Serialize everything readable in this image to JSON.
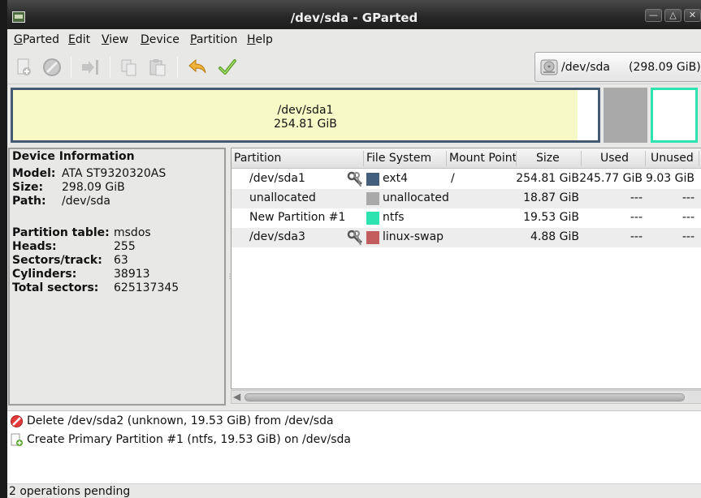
{
  "window": {
    "title": "/dev/sda - GParted"
  },
  "menubar": {
    "items": [
      {
        "mnemonic": "G",
        "rest": "Parted"
      },
      {
        "mnemonic": "E",
        "rest": "dit"
      },
      {
        "mnemonic": "V",
        "rest": "iew"
      },
      {
        "mnemonic": "D",
        "rest": "evice"
      },
      {
        "mnemonic": "P",
        "rest": "artition"
      },
      {
        "mnemonic": "H",
        "rest": "elp"
      }
    ]
  },
  "toolbar": {
    "icons": [
      "new-partition-icon",
      "delete-icon",
      "resize-move-icon",
      "copy-icon",
      "paste-icon",
      "undo-icon",
      "apply-icon"
    ],
    "device_selector": {
      "device": "/dev/sda",
      "size": "(298.09 GiB)",
      "icon": "hard-disk-icon"
    }
  },
  "disk_graphic": {
    "sda1": {
      "name": "/dev/sda1",
      "size": "254.81 GiB",
      "used_fraction": 0.965,
      "border_color": "#445a74",
      "fill_color": "#f7fac6"
    },
    "unallocated": {
      "color": "#a9a9a9"
    },
    "new_partition": {
      "border_color": "#2de3b0"
    }
  },
  "device_info": {
    "heading": "Device Information",
    "model_key": "Model:",
    "model": "ATA ST9320320AS",
    "size_key": "Size:",
    "size": "298.09 GiB",
    "path_key": "Path:",
    "path": "/dev/sda",
    "ptable_key": "Partition table:",
    "ptable": "msdos",
    "heads_key": "Heads:",
    "heads": "255",
    "sectors_key": "Sectors/track:",
    "sectors": "63",
    "cylinders_key": "Cylinders:",
    "cylinders": "38913",
    "total_key": "Total sectors:",
    "total": "625137345"
  },
  "partition_table": {
    "columns": [
      "Partition",
      "File System",
      "Mount Point",
      "Size",
      "Used",
      "Unused"
    ],
    "rows": [
      {
        "partition": "/dev/sda1",
        "fs": "ext4",
        "fs_color": "#435f7d",
        "mount": "/",
        "size": "254.81 GiB",
        "used": "245.77 GiB",
        "unused": "9.03 GiB",
        "locked": true
      },
      {
        "partition": "unallocated",
        "fs": "unallocated",
        "fs_color": "#a9a9a9",
        "mount": "",
        "size": "18.87 GiB",
        "used": "---",
        "unused": "---",
        "locked": false
      },
      {
        "partition": "New Partition #1",
        "fs": "ntfs",
        "fs_color": "#2de3b0",
        "mount": "",
        "size": "19.53 GiB",
        "used": "---",
        "unused": "---",
        "locked": false
      },
      {
        "partition": "/dev/sda3",
        "fs": "linux-swap",
        "fs_color": "#c35c5c",
        "mount": "",
        "size": "4.88 GiB",
        "used": "---",
        "unused": "---",
        "locked": true
      }
    ]
  },
  "operations": [
    {
      "icon": "delete-icon",
      "text": "Delete /dev/sda2 (unknown, 19.53 GiB) from /dev/sda"
    },
    {
      "icon": "new-partition-icon",
      "text": "Create Primary Partition #1 (ntfs, 19.53 GiB) on /dev/sda"
    }
  ],
  "status": {
    "text": "2 operations pending"
  }
}
